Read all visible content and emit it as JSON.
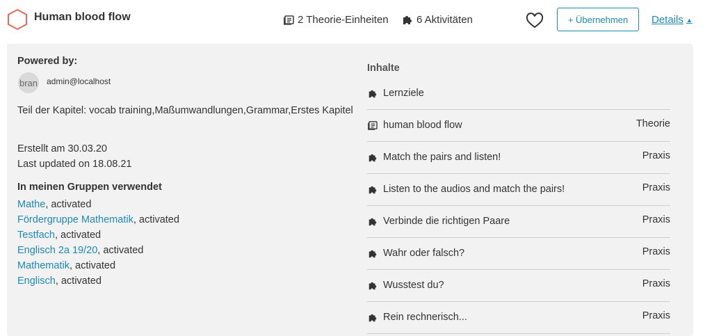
{
  "header": {
    "title": "Human blood flow",
    "theory_units": "2 Theorie-Einheiten",
    "activities": "6 Aktivitäten",
    "adopt_label": "+ Übernehmen",
    "details_label": "Details"
  },
  "info": {
    "powered_by": "Powered by:",
    "avatar_alt": "bran",
    "author": "admin@localhost",
    "chapters": "Teil der Kapitel: vocab training,Maßumwandlungen,Grammar,Erstes Kapitel",
    "created": "Erstellt am 30.03.20",
    "updated": "Last updated on 18.08.21",
    "groups_heading": "In meinen Gruppen verwendet",
    "groups": [
      {
        "name": "Mathe",
        "status": ", activated"
      },
      {
        "name": "Fördergruppe Mathematik",
        "status": ", activated"
      },
      {
        "name": "Testfach",
        "status": ", activated"
      },
      {
        "name": "Englisch 2a 19/20",
        "status": ", activated"
      },
      {
        "name": "Mathematik",
        "status": ", activated"
      },
      {
        "name": "Englisch",
        "status": ", activated"
      }
    ]
  },
  "contents": {
    "heading": "Inhalte",
    "items": [
      {
        "label": "Lernziele",
        "type": "",
        "icon": "puzzle-icon"
      },
      {
        "label": "human blood flow",
        "type": "Theorie",
        "icon": "book-icon"
      },
      {
        "label": "Match the pairs and listen!",
        "type": "Praxis",
        "icon": "puzzle-icon"
      },
      {
        "label": "Listen to the audios and match the pairs!",
        "type": "Praxis",
        "icon": "puzzle-icon"
      },
      {
        "label": "Verbinde die richtigen Paare",
        "type": "Praxis",
        "icon": "puzzle-icon"
      },
      {
        "label": "Wahr oder falsch?",
        "type": "Praxis",
        "icon": "puzzle-icon"
      },
      {
        "label": "Wusstest du?",
        "type": "Praxis",
        "icon": "puzzle-icon"
      },
      {
        "label": "Rein rechnerisch...",
        "type": "Praxis",
        "icon": "puzzle-icon"
      }
    ]
  },
  "colors": {
    "accent": "#1f89b7",
    "hexagon": "#e86a5a",
    "panel": "#f2f2f2"
  }
}
